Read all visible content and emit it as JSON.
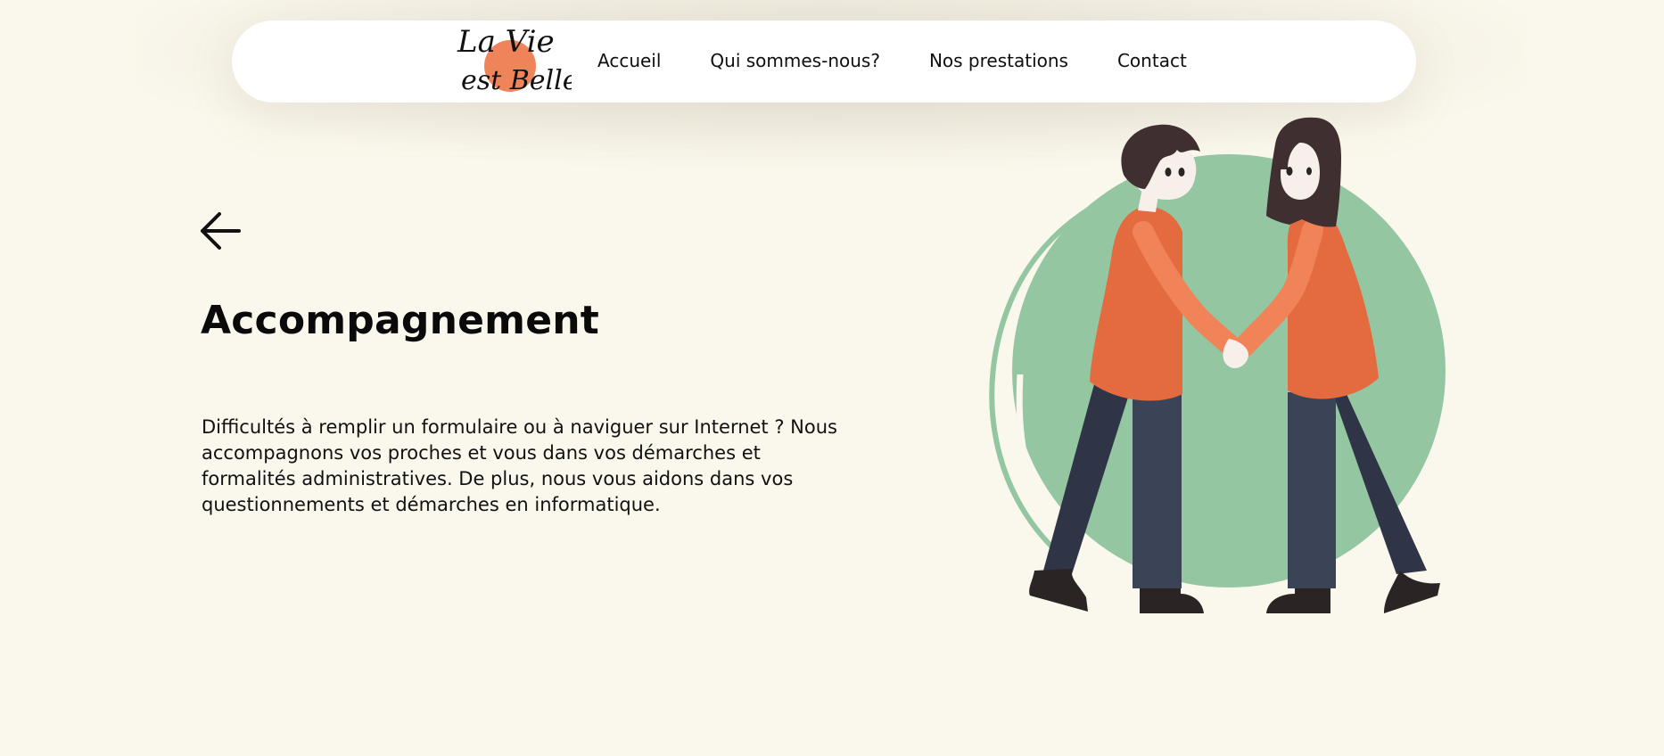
{
  "header": {
    "logo": {
      "line1": "La Vie",
      "line2": "est Belle",
      "accent_color": "#ef845a"
    },
    "nav_items": [
      {
        "label": "Accueil"
      },
      {
        "label": "Qui sommes-nous?"
      },
      {
        "label": "Nos prestations"
      },
      {
        "label": "Contact"
      }
    ]
  },
  "main": {
    "back_icon": "arrow-left-icon",
    "title": "Accompagnement",
    "description": "Difficultés à remplir un formulaire ou à naviguer sur Internet ? Nous accompagnons vos proches et vous dans vos démarches et formalités administratives. De plus, nous vous aidons dans vos questionnements et démarches en informatique."
  },
  "illustration": {
    "icon": "couple-holding-hands-illustration",
    "colors": {
      "background": "#faf7ec",
      "circle": "#94c6a2",
      "shirt": "#e46b3f",
      "arm": "#f08358",
      "trousers_dark": "#2f3447",
      "trousers_light": "#3a4456",
      "hair": "#3f2f30",
      "shoes": "#2b2424",
      "skin": "#f7efea"
    }
  }
}
